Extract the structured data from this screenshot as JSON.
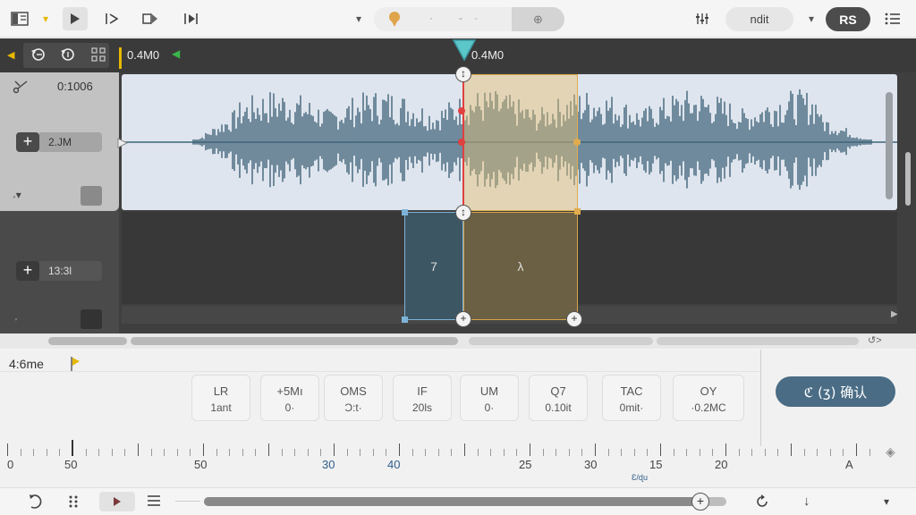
{
  "toolbar": {
    "menu_arrow": "▾",
    "pill_glyph_1": "·",
    "pill_glyph_2": "-",
    "edit_label": "ndit",
    "user_initials": "RS",
    "split_glyph": "⊕"
  },
  "ruler": {
    "left_time": "0.4M0",
    "playhead_time": "0.4M0"
  },
  "tracks": [
    {
      "time": "0:1006",
      "gain": "2.JM"
    },
    {
      "gain": "13:3l"
    }
  ],
  "clips": {
    "blue_label": "7",
    "yellow_label": "λ"
  },
  "panel": {
    "duration": "4:6me",
    "params": [
      {
        "label": "LR",
        "value": "1ant"
      },
      {
        "label": "+5Mı",
        "value": "0·"
      },
      {
        "label": "OMS",
        "value": "Ɔ:t·"
      },
      {
        "label": "IF",
        "value": "20ls"
      },
      {
        "label": "UM",
        "value": "0·"
      },
      {
        "label": "Q7",
        "value": "0.10it"
      },
      {
        "label": "TAC",
        "value": "0mit·"
      },
      {
        "label": "OY",
        "value": "·0.2MC"
      }
    ],
    "confirm_label": "ℭ (ʒ) 确认"
  },
  "scale": {
    "labels": [
      "0",
      "50",
      "50",
      "30",
      "40",
      "25",
      "30",
      "15",
      "20",
      "A"
    ],
    "sub_label": "Ɛ/ɖu",
    "highlight_color": "#2f5e8c"
  },
  "playback": {
    "progress": 0.95
  },
  "colors": {
    "accent": "#4a6c85",
    "selection_yellow": "#e0ac4e",
    "selection_blue": "#7eb2d6",
    "playhead": "#e04040",
    "waveform": "#3f6478"
  }
}
